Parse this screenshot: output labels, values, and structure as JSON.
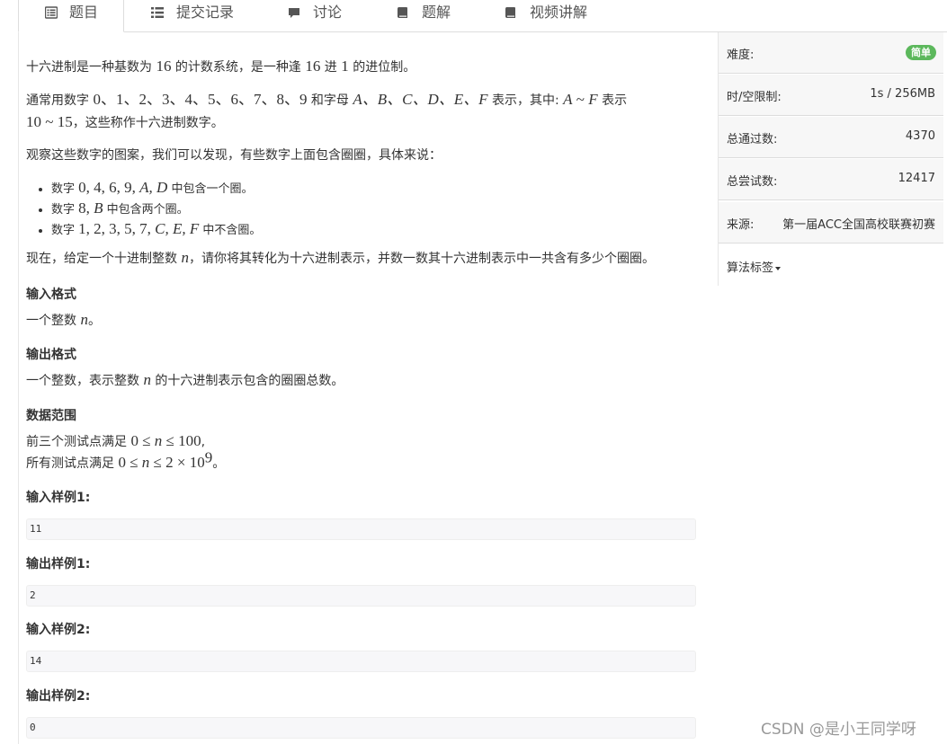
{
  "tabs": [
    {
      "label": "题目",
      "icon": "list-alt-icon",
      "active": true
    },
    {
      "label": "提交记录",
      "icon": "list-icon",
      "active": false
    },
    {
      "label": "讨论",
      "icon": "comment-icon",
      "active": false
    },
    {
      "label": "题解",
      "icon": "book-icon",
      "active": false
    },
    {
      "label": "视频讲解",
      "icon": "book-icon",
      "active": false
    }
  ],
  "problem": {
    "intro1": [
      "十六进制是一种基数为 ",
      "16",
      " 的计数系统，是一种逢 ",
      "16",
      " 进 ",
      "1",
      " 的进位制。"
    ],
    "intro2": [
      "通常用数字 ",
      "0、1、2、3、4、5、6、7、8、9",
      " 和字母 ",
      "A、B、C、D、E、F",
      " 表示，其中: ",
      "A",
      " ~ ",
      "F",
      " 表示",
      "10 ~ 15",
      "，这些称作十六进制数字。"
    ],
    "intro3": "观察这些数字的图案，我们可以发现，有些数字上面包含圈圈，具体来说：",
    "bullets": [
      {
        "pre": "数字 ",
        "digits": "0, 4, 6, 9, ",
        "letters": "A, D",
        "post": " 中包含一个圈。"
      },
      {
        "pre": "数字 ",
        "digits": "8, ",
        "letters": "B",
        "post": " 中包含两个圈。"
      },
      {
        "pre": "数字 ",
        "digits": "1, 2, 3, 5, 7, ",
        "letters": "C, E, F",
        "post": " 中不含圈。"
      }
    ],
    "task": [
      "现在，给定一个十进制整数 ",
      "n",
      "，请你将其转化为十六进制表示，并数一数其十六进制表示中一共含有多少个圈圈。"
    ],
    "input_heading": "输入格式",
    "input_text": [
      "一个整数 ",
      "n",
      "。"
    ],
    "output_heading": "输出格式",
    "output_text": [
      "一个整数，表示整数 ",
      "n",
      " 的十六进制表示包含的圈圈总数。"
    ],
    "range_heading": "数据范围",
    "range_line1": [
      "前三个测试点满足 ",
      "0 ≤ ",
      "n",
      " ≤ 100",
      ","
    ],
    "range_line2": [
      "所有测试点满足 ",
      "0 ≤ ",
      "n",
      " ≤ 2 × 10",
      "9",
      "。"
    ],
    "samples": [
      {
        "label": "输入样例1:",
        "value": "11"
      },
      {
        "label": "输出样例1:",
        "value": "2"
      },
      {
        "label": "输入样例2:",
        "value": "14"
      },
      {
        "label": "输出样例2:",
        "value": "0"
      }
    ]
  },
  "sidebar": {
    "difficulty_label": "难度:",
    "difficulty_value": "简单",
    "difficulty_color": "#5cb85c",
    "limit_label": "时/空限制:",
    "limit_value": "1s / 256MB",
    "accepted_label": "总通过数:",
    "accepted_value": "4370",
    "attempts_label": "总尝试数:",
    "attempts_value": "12417",
    "source_label": "来源:",
    "source_value": "第一届ACC全国高校联赛初赛",
    "tags_label": "算法标签"
  },
  "watermark": "CSDN @是小王同学呀"
}
